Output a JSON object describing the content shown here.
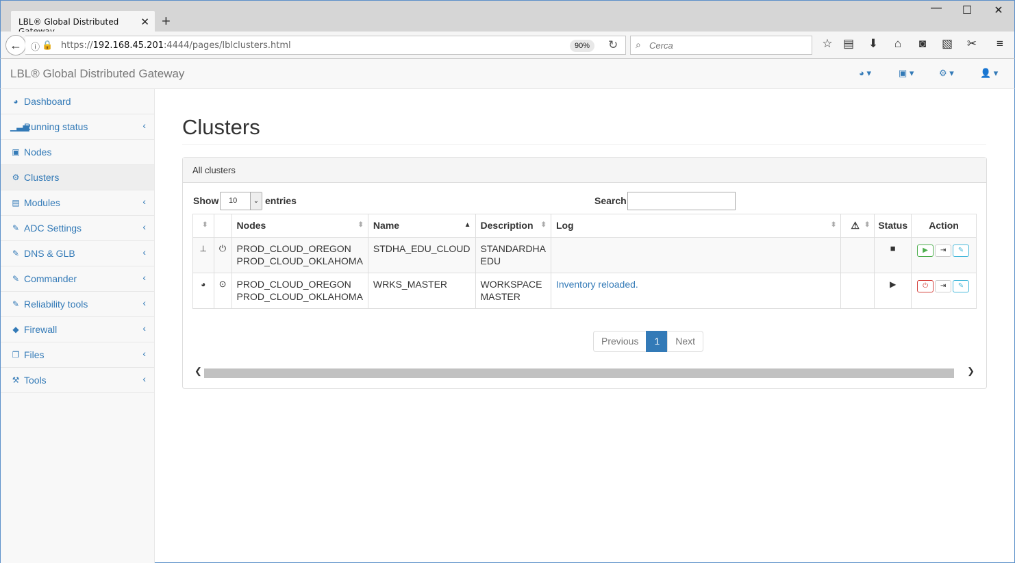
{
  "browser": {
    "tab_title": "LBL® Global Distributed Gateway",
    "tab_close": "✕",
    "new_tab": "+",
    "url_prefix": "https://",
    "url_host": "192.168.45.201",
    "url_rest": ":4444/pages/lblclusters.html",
    "zoom": "90%",
    "search_placeholder": "Cerca"
  },
  "header": {
    "brand": "LBL® Global Distributed Gateway"
  },
  "sidebar": {
    "items": [
      {
        "label": "Dashboard",
        "icon": "dashboard-icon",
        "glyph": "◕",
        "has_arrow": false
      },
      {
        "label": "Running status",
        "icon": "bar-chart-icon",
        "glyph": "▁▃▅",
        "has_arrow": true
      },
      {
        "label": "Nodes",
        "icon": "cube-icon",
        "glyph": "▣",
        "has_arrow": false
      },
      {
        "label": "Clusters",
        "icon": "cogs-icon",
        "glyph": "⚙",
        "has_arrow": false
      },
      {
        "label": "Modules",
        "icon": "list-alt-icon",
        "glyph": "▤",
        "has_arrow": true
      },
      {
        "label": "ADC Settings",
        "icon": "edit-icon",
        "glyph": "✎",
        "has_arrow": true
      },
      {
        "label": "DNS & GLB",
        "icon": "edit-icon",
        "glyph": "✎",
        "has_arrow": true
      },
      {
        "label": "Commander",
        "icon": "edit-icon",
        "glyph": "✎",
        "has_arrow": true
      },
      {
        "label": "Reliability tools",
        "icon": "edit-icon",
        "glyph": "✎",
        "has_arrow": true
      },
      {
        "label": "Firewall",
        "icon": "shield-icon",
        "glyph": "◆",
        "has_arrow": true
      },
      {
        "label": "Files",
        "icon": "files-icon",
        "glyph": "❐",
        "has_arrow": true
      },
      {
        "label": "Tools",
        "icon": "wrench-icon",
        "glyph": "⚒",
        "has_arrow": true
      }
    ],
    "arrow": "‹"
  },
  "main": {
    "title": "Clusters",
    "panel_title": "All clusters",
    "show_label": "Show",
    "entries_value": "10",
    "entries_label": "entries",
    "search_label": "Search:",
    "columns": [
      "Nodes",
      "Name",
      "Description",
      "Log",
      "Status",
      "Action"
    ],
    "rows": [
      {
        "nodes_line1": "PROD_CLOUD_OREGON",
        "nodes_line2": "PROD_CLOUD_OKLAHOMA",
        "name": "STDHA_EDU_CLOUD",
        "desc_line1": "STANDARDHA",
        "desc_line2": "EDU",
        "log": "",
        "type_icon": "sitemap-icon",
        "state_icon": "power-icon",
        "status_icon": "stop-icon"
      },
      {
        "nodes_line1": "PROD_CLOUD_OREGON",
        "nodes_line2": "PROD_CLOUD_OKLAHOMA",
        "name": "WRKS_MASTER",
        "desc_line1": "WORKSPACE",
        "desc_line2": "MASTER",
        "log": "Inventory reloaded.",
        "type_icon": "dashboard-icon",
        "state_icon": "play-circle-icon",
        "status_icon": "play-icon"
      }
    ],
    "pagination": {
      "previous": "Previous",
      "current": "1",
      "next": "Next"
    }
  },
  "colors": {
    "link": "#337ab7",
    "active_page": "#337ab7",
    "start_button": "#4cae4c",
    "stop_button": "#d43f3a",
    "edit_button": "#46b8da"
  }
}
